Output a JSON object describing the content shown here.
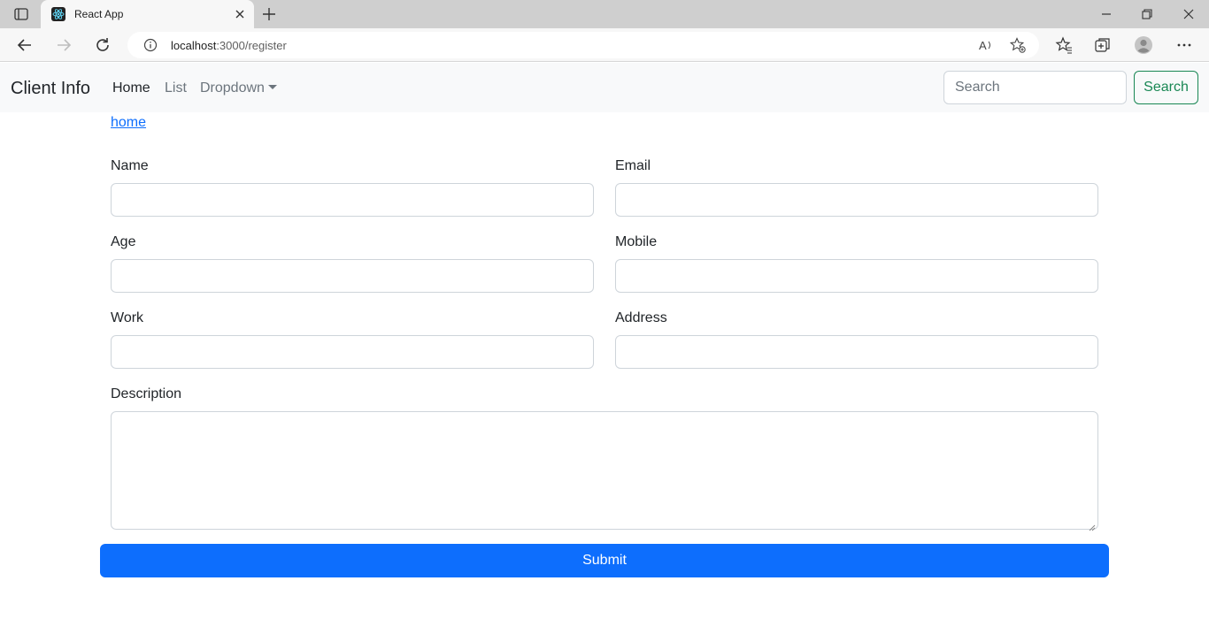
{
  "browser": {
    "tab_title": "React App",
    "url_host": "localhost",
    "url_path": ":3000/register"
  },
  "navbar": {
    "brand": "Client Info",
    "links": [
      {
        "label": "Home"
      },
      {
        "label": "List"
      },
      {
        "label": "Dropdown"
      }
    ],
    "search_placeholder": "Search",
    "search_button": "Search"
  },
  "page": {
    "home_link": "home",
    "fields": {
      "name": {
        "label": "Name",
        "value": ""
      },
      "email": {
        "label": "Email",
        "value": ""
      },
      "age": {
        "label": "Age",
        "value": ""
      },
      "mobile": {
        "label": "Mobile",
        "value": ""
      },
      "work": {
        "label": "Work",
        "value": ""
      },
      "address": {
        "label": "Address",
        "value": ""
      },
      "description": {
        "label": "Description",
        "value": ""
      }
    },
    "submit_label": "Submit"
  },
  "colors": {
    "primary": "#0d6efd",
    "success": "#198754",
    "navbar_bg": "#f8f9fa"
  }
}
